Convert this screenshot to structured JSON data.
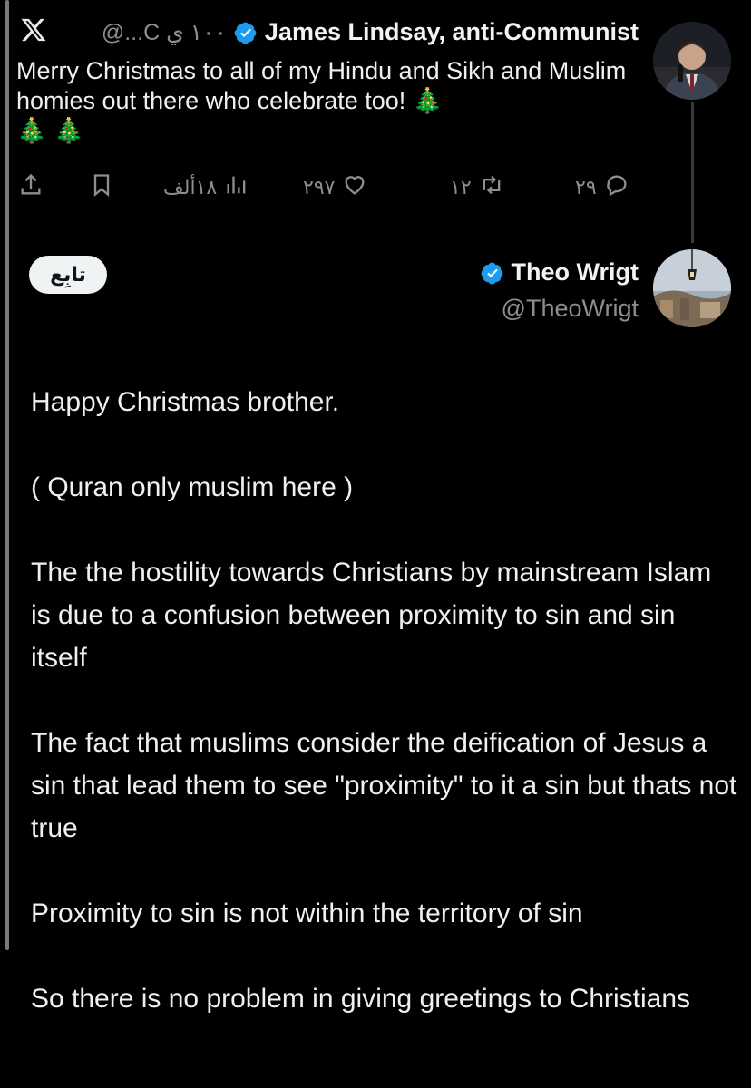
{
  "top_tweet": {
    "app_icon": "x-logo-icon",
    "handle_meta": "١٠٠ ي C...@",
    "author_name": "James Lindsay, anti-Communist",
    "text": "Merry Christmas to all of my Hindu and Sikh and Muslim homies out there who celebrate too! 🎄",
    "emoji_line": "🎄 🎄",
    "actions": {
      "views": "١٨ألف",
      "likes": "٢٩٧",
      "retweets": "١٢",
      "replies": "٢٩"
    }
  },
  "reply": {
    "follow_label": "تابِع",
    "author_name": "Theo Wrigt",
    "handle": "@TheoWrigt",
    "paragraphs": [
      "Happy Christmas brother.",
      "( Quran only muslim here )",
      "The the hostility towards Christians by mainstream Islam is due to a confusion between proximity to sin and sin itself",
      "The fact that muslims consider the deification of Jesus a sin that lead them to see \"proximity\" to it a sin but thats not true",
      "Proximity to sin is not within the territory of sin",
      "So there is no problem in giving  greetings to Christians"
    ]
  },
  "colors": {
    "background": "#000000",
    "text": "#e7e9ea",
    "muted": "#8b8f93",
    "verified": "#1d9bf0"
  }
}
